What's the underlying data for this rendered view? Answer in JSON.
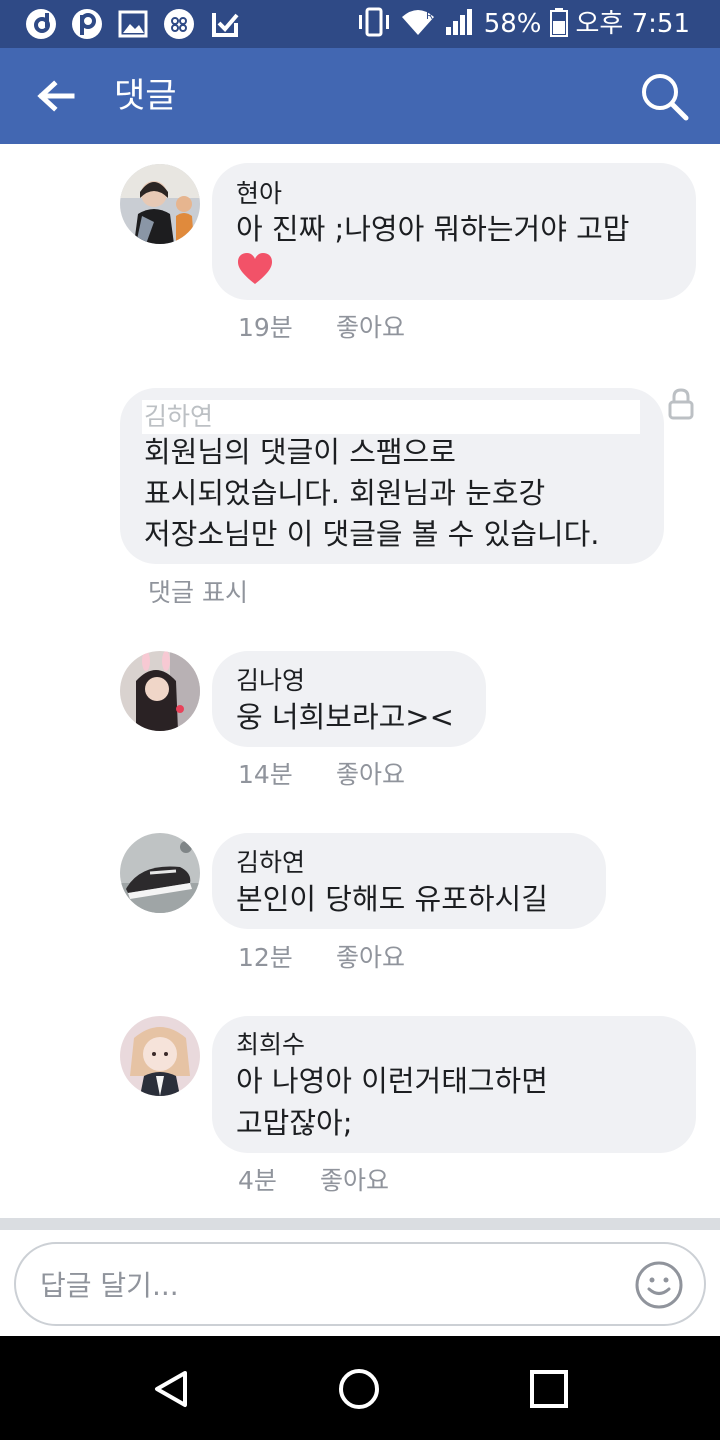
{
  "status_bar": {
    "battery": "58%",
    "time": "오후 7:51",
    "left_icons": [
      "d-app-icon",
      "p-app-icon",
      "gallery-icon",
      "messenger-icon",
      "check-app-icon"
    ],
    "right_icons": [
      "vibrate-icon",
      "wifi-icon",
      "signal-icon",
      "battery-icon"
    ]
  },
  "app_bar": {
    "title": "댓글",
    "back_icon": "arrow-left-icon",
    "search_icon": "search-icon"
  },
  "comments": [
    {
      "name": "현아",
      "text_line1": "아 진짜 ;나영아 뭐하는거야 고맙",
      "emoji": "heart",
      "time": "19분",
      "like": "좋아요"
    },
    {
      "name": "김하연",
      "spam_line1": "회원님의 댓글이 스팸으로",
      "spam_line2": "표시되었습니다. 회원님과 눈호강",
      "spam_line3": "저장소님만 이 댓글을 볼 수 있습니다.",
      "action": "댓글 표시",
      "lock_icon": "lock-icon"
    },
    {
      "name": "김나영",
      "text": "웅 너희보라고><",
      "time": "14분",
      "like": "좋아요"
    },
    {
      "name": "김하연",
      "text": "본인이 당해도 유포하시길",
      "time": "12분",
      "like": "좋아요"
    },
    {
      "name": "최희수",
      "text_line1": "아 나영아 이런거태그하면",
      "text_line2": "고맙잖아;",
      "time": "4분",
      "like": "좋아요"
    }
  ],
  "composer": {
    "placeholder": "답글 달기...",
    "emoji_icon": "smiley-icon"
  },
  "nav_bar": {
    "icons": [
      "back-triangle-icon",
      "home-circle-icon",
      "recents-square-icon"
    ]
  },
  "colors": {
    "status_bar": "#2f4a86",
    "app_bar": "#4267b2",
    "bubble": "#f0f1f4",
    "meta_text": "#90949c",
    "heart": "#f25268"
  }
}
